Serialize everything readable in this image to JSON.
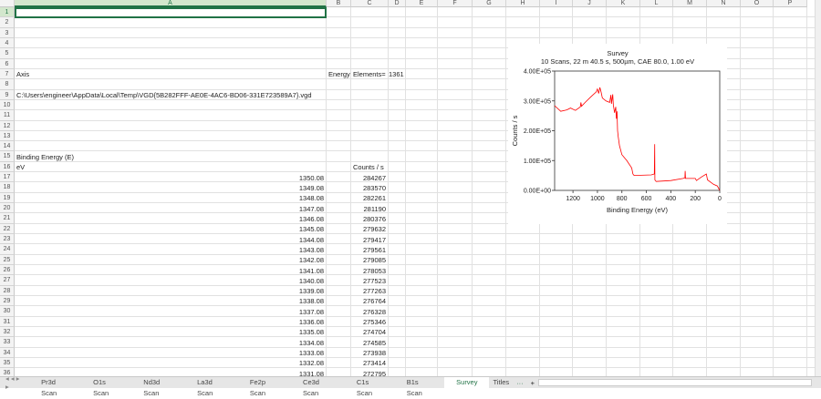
{
  "columns": [
    "A",
    "B",
    "C",
    "D",
    "E",
    "F",
    "G",
    "H",
    "I",
    "J",
    "K",
    "L",
    "M",
    "N",
    "O",
    "P"
  ],
  "cells": {
    "A7": "Axis",
    "B7": "Energy",
    "C7": "Elements=",
    "D7": "1361",
    "A9": "C:\\Users\\engineer\\AppData\\Local\\Temp\\VGD{5B282FFF-AE0E-4AC6-BD06-331E723589A7}.vgd",
    "A15": "Binding Energy (E)",
    "A16": "eV",
    "C16": "Counts / s"
  },
  "data_rows": [
    [
      "1350.08",
      "284267"
    ],
    [
      "1349.08",
      "283570"
    ],
    [
      "1348.08",
      "282261"
    ],
    [
      "1347.08",
      "281190"
    ],
    [
      "1346.08",
      "280376"
    ],
    [
      "1345.08",
      "279632"
    ],
    [
      "1344.08",
      "279417"
    ],
    [
      "1343.08",
      "279561"
    ],
    [
      "1342.08",
      "279085"
    ],
    [
      "1341.08",
      "278053"
    ],
    [
      "1340.08",
      "277523"
    ],
    [
      "1339.08",
      "277263"
    ],
    [
      "1338.08",
      "276764"
    ],
    [
      "1337.08",
      "276328"
    ],
    [
      "1336.08",
      "275346"
    ],
    [
      "1335.08",
      "274704"
    ],
    [
      "1334.08",
      "274585"
    ],
    [
      "1333.08",
      "273938"
    ],
    [
      "1332.08",
      "273414"
    ],
    [
      "1331.08",
      "272795"
    ]
  ],
  "sheet_tabs": [
    "Pr3d Scan",
    "O1s Scan",
    "Nd3d Scan",
    "La3d Scan",
    "Fe2p Scan",
    "Ce3d Scan",
    "C1s Scan",
    "B1s Scan",
    "Survey",
    "Titles"
  ],
  "active_tab": "Survey",
  "tab_more": "···",
  "tab_add": "+",
  "chart_data": {
    "type": "line",
    "title": "Survey",
    "subtitle": "10 Scans,  22 m 40.5 s,  500µm,  CAE 80.0,  1.00 eV",
    "xlabel": "Binding Energy (eV)",
    "ylabel": "Counts / s",
    "xlim": [
      1350,
      0
    ],
    "ylim": [
      0,
      400000
    ],
    "xticks": [
      "1200",
      "1000",
      "800",
      "600",
      "400",
      "200",
      "0"
    ],
    "xtick_values": [
      1200,
      1000,
      800,
      600,
      400,
      200,
      0
    ],
    "yticks": [
      "0.00E+00",
      "1.00E+05",
      "2.00E+05",
      "3.00E+05",
      "4.00E+05"
    ],
    "ytick_values": [
      0,
      100000,
      200000,
      300000,
      400000
    ],
    "color": "#ff0000",
    "series": [
      {
        "name": "Survey",
        "x": [
          1350,
          1300,
          1250,
          1220,
          1180,
          1140,
          1135,
          1130,
          1100,
          1050,
          1010,
          1000,
          990,
          980,
          970,
          960,
          930,
          900,
          890,
          885,
          875,
          870,
          860,
          850,
          845,
          840,
          835,
          830,
          820,
          800,
          760,
          720,
          710,
          700,
          560,
          535,
          532,
          530,
          520,
          400,
          300,
          285,
          283,
          280,
          200,
          190,
          150,
          110,
          100,
          50,
          20,
          0
        ],
        "y": [
          284000,
          265000,
          270000,
          276000,
          268000,
          280000,
          295000,
          282000,
          295000,
          315000,
          330000,
          340000,
          325000,
          345000,
          330000,
          310000,
          300000,
          295000,
          320000,
          290000,
          322000,
          285000,
          260000,
          280000,
          240000,
          265000,
          200000,
          180000,
          150000,
          120000,
          100000,
          75000,
          55000,
          50000,
          52000,
          55000,
          155000,
          35000,
          30000,
          33000,
          40000,
          42000,
          65000,
          40000,
          40000,
          33000,
          45000,
          55000,
          35000,
          20000,
          15000,
          0
        ]
      }
    ]
  }
}
